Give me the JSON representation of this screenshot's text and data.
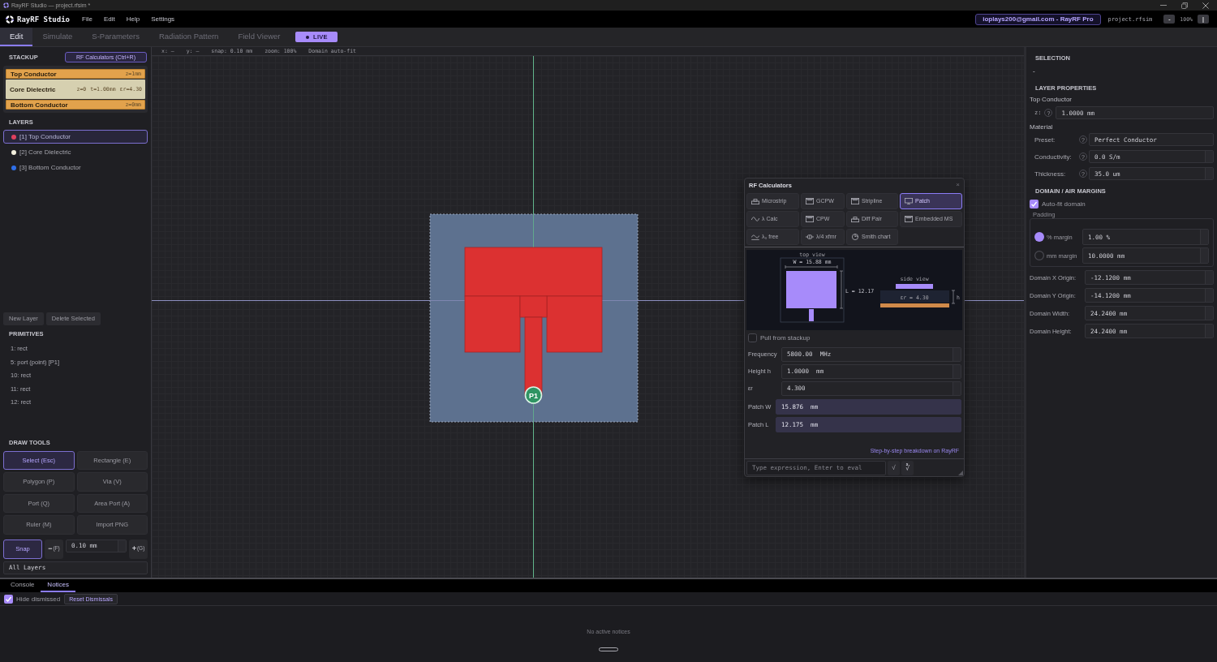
{
  "window": {
    "title": "RayRF Studio — project.rfsim *"
  },
  "menu_bar": {
    "app_name": "RayRF Studio",
    "menus": [
      "File",
      "Edit",
      "Help",
      "Settings"
    ],
    "account": "ioplays200@gmail.com - RayRF Pro",
    "file_name": "project.rfsim",
    "zoom_out": "-",
    "zoom": "100%",
    "zoom_in": "|"
  },
  "tabs": [
    {
      "label": "Edit",
      "selected": true
    },
    {
      "label": "Simulate",
      "selected": false
    },
    {
      "label": "S-Parameters",
      "selected": false
    },
    {
      "label": "Radiation Pattern",
      "selected": false
    },
    {
      "label": "Field Viewer",
      "selected": false
    }
  ],
  "live_badge": {
    "label": "LIVE"
  },
  "stackup": {
    "title": "STACKUP",
    "calculator_button": "RF Calculators (Ctrl+R)",
    "layers": [
      {
        "name": "Top Conductor",
        "kind": "conductor",
        "params": [
          "z=1mm"
        ]
      },
      {
        "name": "Core Dielectric",
        "kind": "dielectric",
        "params": [
          "z=0",
          "t=1.00mm",
          "εr=4.30"
        ]
      },
      {
        "name": "Bottom Conductor",
        "kind": "conductor",
        "params": [
          "z=0mm"
        ]
      }
    ]
  },
  "layers": {
    "title": "LAYERS",
    "items": [
      {
        "label": "[1] Top Conductor",
        "color": "#e0405e",
        "selected": true
      },
      {
        "label": "[2] Core Dielectric",
        "color": "#f2eedc",
        "selected": false
      },
      {
        "label": "[3] Bottom Conductor",
        "color": "#2f6fe8",
        "selected": false
      }
    ]
  },
  "layer_actions": [
    "New Layer",
    "Delete Selected"
  ],
  "primitives": {
    "title": "PRIMITIVES",
    "items": [
      "1: rect",
      "5: port (point) [P1]",
      "10: rect",
      "11: rect",
      "12: rect"
    ]
  },
  "draw_tools": {
    "title": "DRAW TOOLS",
    "tools": [
      {
        "label": "Select (Esc)",
        "selected": true
      },
      {
        "label": "Rectangle (E)",
        "selected": false
      },
      {
        "label": "Polygon (P)",
        "selected": false
      },
      {
        "label": "Via (V)",
        "selected": false
      },
      {
        "label": "Port (Q)",
        "selected": false
      },
      {
        "label": "Area Port (A)",
        "selected": false
      },
      {
        "label": "Ruler (M)",
        "selected": false
      },
      {
        "label": "Import PNG",
        "selected": false
      }
    ]
  },
  "snap": {
    "label": "Snap",
    "on": true,
    "decrease": {
      "label": "−",
      "key": "(F)"
    },
    "value": "0.10 mm",
    "increase": {
      "label": "+",
      "key": "(G)"
    }
  },
  "layer_filter": {
    "value": "All Layers"
  },
  "canvas": {
    "status": [
      "x: —",
      "y: —",
      "snap: 0.10 mm",
      "zoom: 100%",
      "Domain auto-fit"
    ],
    "port_label": "P1"
  },
  "rf_calculators": {
    "title": "RF Calculators",
    "close": "×",
    "calculators": [
      {
        "label": "Microstrip",
        "kind": "strip",
        "selected": false
      },
      {
        "label": "GCPW",
        "kind": "board",
        "selected": false
      },
      {
        "label": "Stripline",
        "kind": "board",
        "selected": false
      },
      {
        "label": "Patch",
        "kind": "screen",
        "selected": true
      },
      {
        "label": "λ Calc",
        "kind": "wave",
        "selected": false
      },
      {
        "label": "CPW",
        "kind": "board",
        "selected": false
      },
      {
        "label": "Diff Pair",
        "kind": "strip",
        "selected": false
      },
      {
        "label": "Embedded MS",
        "kind": "board",
        "selected": false
      },
      {
        "label": "λ₀ free",
        "kind": "wave_line",
        "selected": false
      },
      {
        "label": "λ/4 xfmr",
        "kind": "coil",
        "selected": false
      },
      {
        "label": "Smith chart",
        "kind": "dial",
        "selected": false
      }
    ],
    "diagram": {
      "top_view": "top view",
      "width_label": "W = 15.88 mm",
      "length_label": "L = 12.17",
      "side_view": "side view",
      "permittivity_label": "εr = 4.30",
      "height_label": "h"
    },
    "pull_from_stackup": {
      "label": "Pull from stackup",
      "checked": false
    },
    "inputs": [
      {
        "label": "Frequency",
        "value": "5800.00  MHz"
      },
      {
        "label": "Height h",
        "value": "1.0000  mm"
      },
      {
        "label": "εr",
        "value": "4.300"
      }
    ],
    "results": [
      {
        "label": "Patch W",
        "value": "15.876  mm"
      },
      {
        "label": "Patch L",
        "value": "12.175  mm"
      }
    ],
    "link": "Step-by-step breakdown on RayRF",
    "expression": {
      "placeholder": "Type expression, Enter to eval",
      "buttons": [
        "√",
        "∛"
      ]
    }
  },
  "properties": {
    "selection": {
      "title": "SELECTION",
      "value": "-"
    },
    "layer_properties": {
      "title": "LAYER PROPERTIES",
      "layer_name": "Top Conductor",
      "z": {
        "label": "z:",
        "help": "?",
        "value": "1.0000 mm"
      },
      "material_title": "Material",
      "material": [
        {
          "label": "Preset:",
          "help": "?",
          "value": "Perfect Conductor",
          "kind": "text"
        },
        {
          "label": "Conductivity:",
          "help": "?",
          "value": "0.0 S/m",
          "kind": "number"
        },
        {
          "label": "Thickness:",
          "help": "?",
          "value": "35.0 um",
          "kind": "number"
        }
      ]
    },
    "domain": {
      "title": "DOMAIN / AIR MARGINS",
      "auto_fit": {
        "label": "Auto-fit domain",
        "checked": true
      },
      "padding": {
        "title": "Padding",
        "options": [
          {
            "label": "% margin",
            "selected": true,
            "value": "1.00 %"
          },
          {
            "label": "mm margin",
            "selected": false,
            "value": "10.0000 mm"
          }
        ]
      },
      "fields": [
        {
          "label": "Domain X Origin:",
          "value": "-12.1200 mm"
        },
        {
          "label": "Domain Y Origin:",
          "value": "-14.1200 mm"
        },
        {
          "label": "Domain Width:",
          "value": "24.2400 mm"
        },
        {
          "label": "Domain Height:",
          "value": "24.2400 mm"
        }
      ]
    }
  },
  "bottom_panel": {
    "tabs": [
      {
        "label": "Console",
        "selected": false
      },
      {
        "label": "Notices",
        "selected": true
      }
    ],
    "hide_dismissed": {
      "label": "Hide dismissed",
      "checked": true
    },
    "reset_button": "Reset Dismissals",
    "empty_message": "No active notices"
  }
}
